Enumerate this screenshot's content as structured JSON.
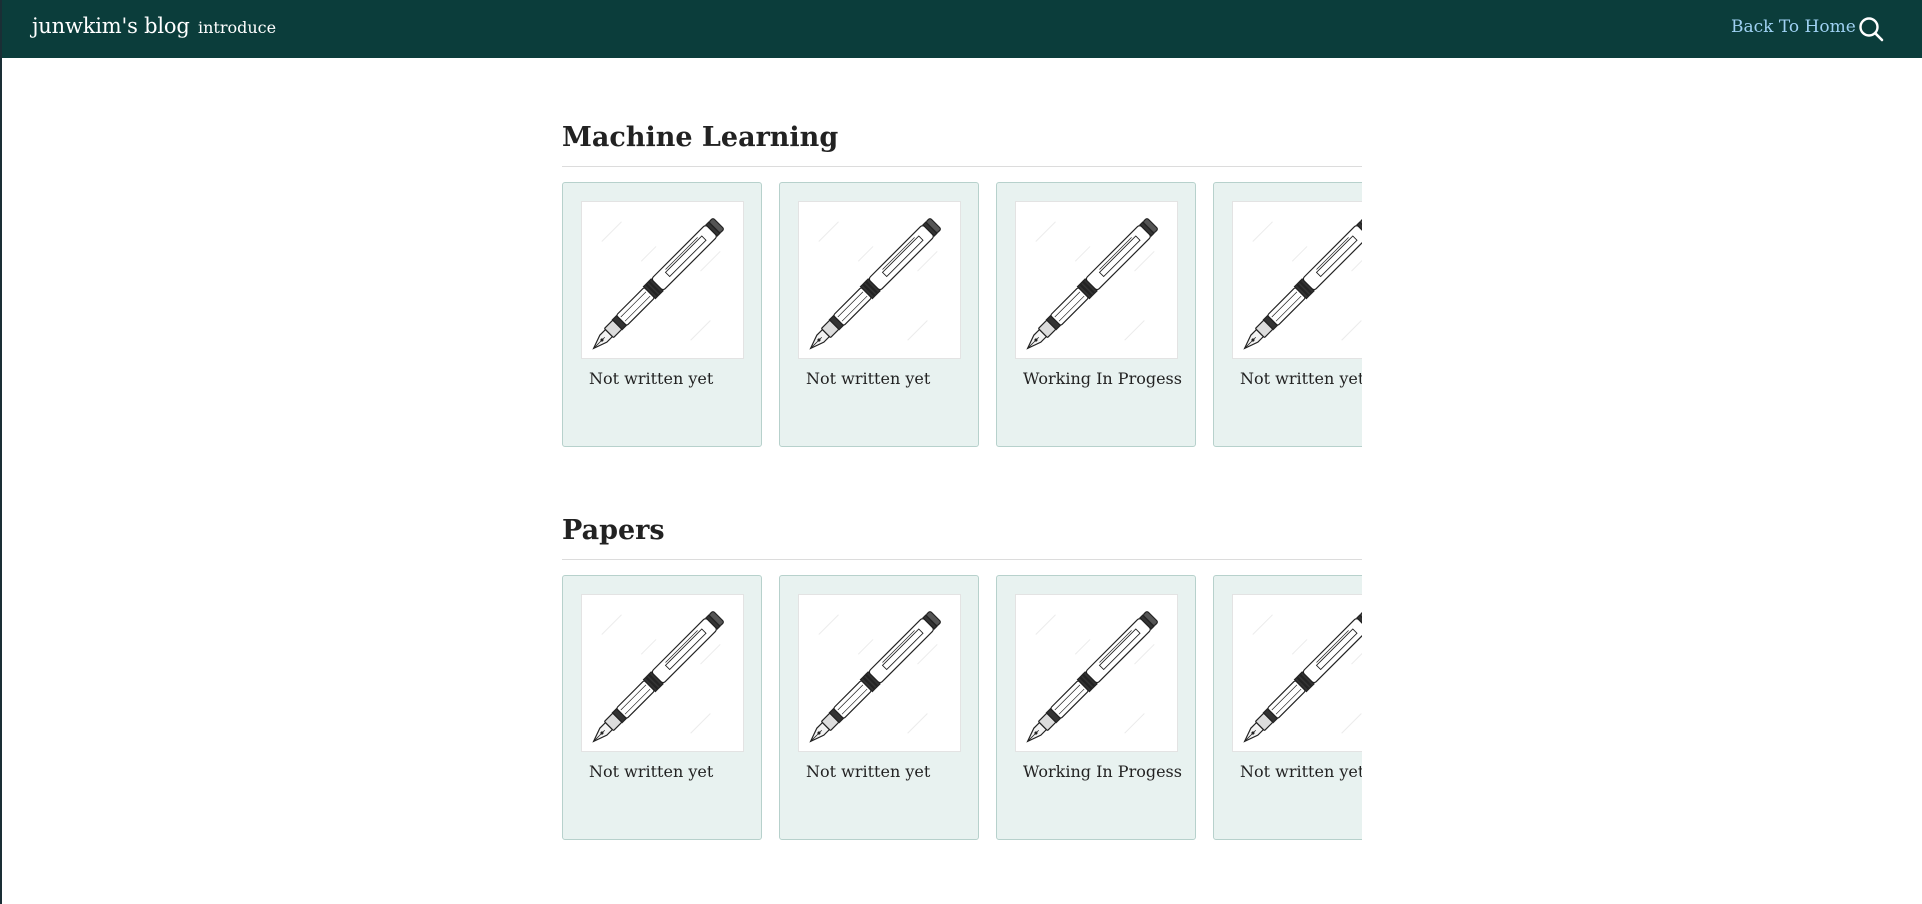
{
  "nav": {
    "brand": "junwkim's blog",
    "links": [
      {
        "label": "introduce"
      }
    ],
    "back_home": "Back To Home",
    "search_icon": "search-icon"
  },
  "sections": [
    {
      "title": "Machine Learning",
      "cards": [
        {
          "label": "Not written yet",
          "icon": "fountain-pen-icon"
        },
        {
          "label": "Not written yet",
          "icon": "fountain-pen-icon"
        },
        {
          "label": "Working In Progess",
          "icon": "fountain-pen-icon"
        },
        {
          "label": "Not written yet",
          "icon": "fountain-pen-icon"
        }
      ]
    },
    {
      "title": "Papers",
      "cards": [
        {
          "label": "Not written yet",
          "icon": "fountain-pen-icon"
        },
        {
          "label": "Not written yet",
          "icon": "fountain-pen-icon"
        },
        {
          "label": "Working In Progess",
          "icon": "fountain-pen-icon"
        },
        {
          "label": "Not written yet",
          "icon": "fountain-pen-icon"
        }
      ]
    }
  ],
  "colors": {
    "nav_background": "#0b3d3b",
    "back_home_link": "#9fd1f3",
    "card_background": "#e8f2f0",
    "card_border": "#b7d1cc"
  }
}
